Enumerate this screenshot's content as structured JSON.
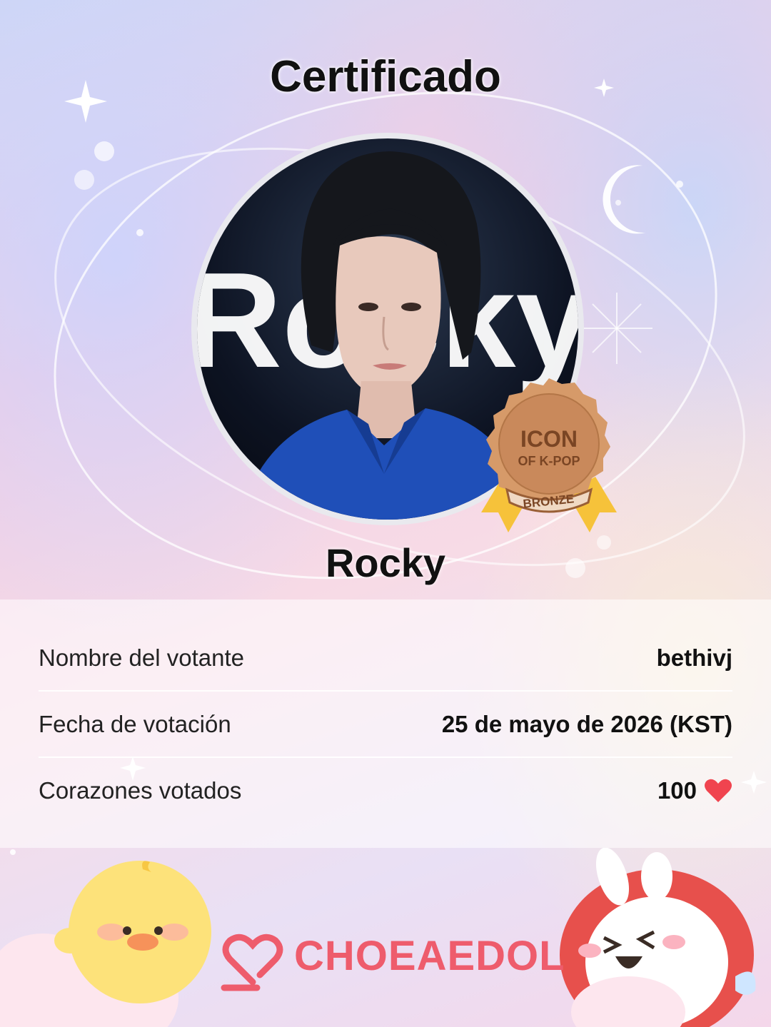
{
  "certificate": {
    "title": "Certificado",
    "idol_name": "Rocky",
    "badge": {
      "line1": "ICON",
      "line2": "OF K-POP",
      "tier": "BRONZE"
    },
    "rows": [
      {
        "label": "Nombre del votante",
        "value": "bethivj"
      },
      {
        "label": "Fecha de votación",
        "value": "25 de mayo de 2026 (KST)"
      },
      {
        "label": "Corazones votados",
        "value": "100"
      }
    ],
    "brand": "CHOEAEDOL",
    "portrait_backdrop_text": "Rocky"
  },
  "colors": {
    "brand": "#ee5c6c",
    "heart": "#f0444f",
    "badge_bronze": "#c9895b",
    "ribbon": "#f6c23a"
  },
  "icons": [
    "sparkle-icon",
    "moon-icon",
    "heart-icon",
    "brand-logo-icon"
  ]
}
